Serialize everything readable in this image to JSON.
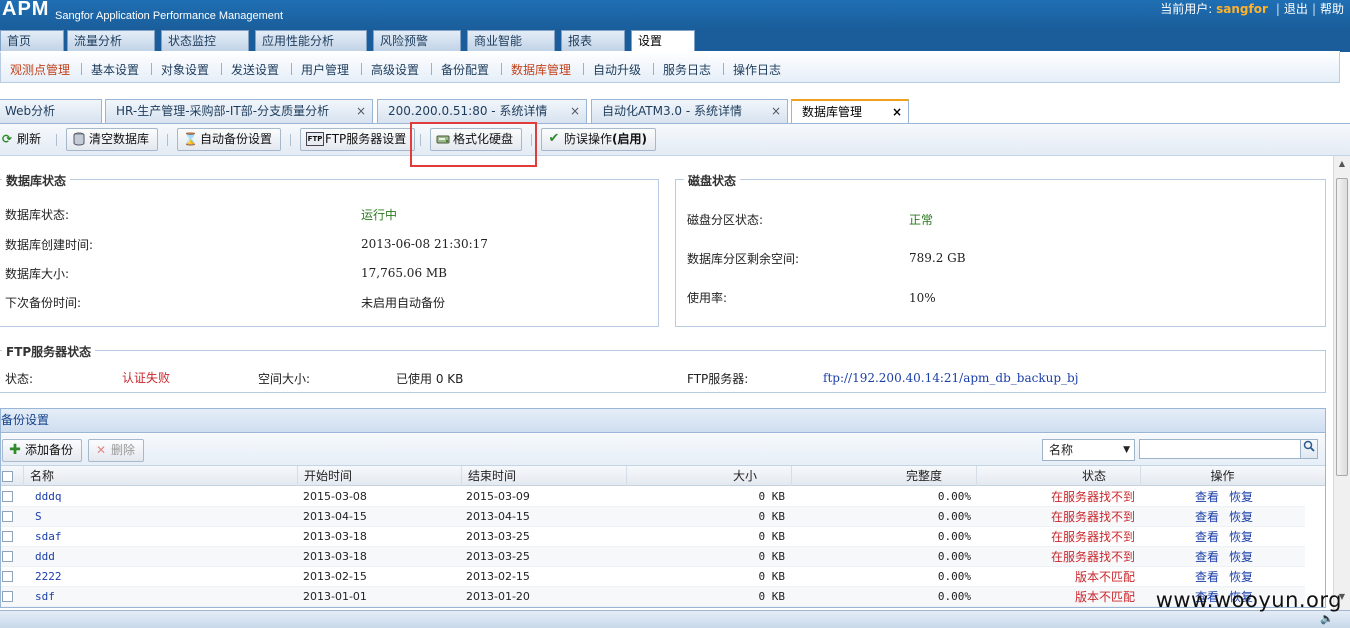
{
  "header": {
    "logo": "APM",
    "subtitle": "Sangfor Application Performance Management",
    "current_user_label": "当前用户:",
    "username": "sangfor",
    "logout": "退出",
    "help": "帮助"
  },
  "main_nav": [
    "首页",
    "流量分析",
    "状态监控",
    "应用性能分析",
    "风险预警",
    "商业智能",
    "报表",
    "设置"
  ],
  "sub_nav": [
    "观测点管理",
    "基本设置",
    "对象设置",
    "发送设置",
    "用户管理",
    "高级设置",
    "备份配置",
    "数据库管理",
    "自动升级",
    "服务日志",
    "操作日志"
  ],
  "page_tabs": [
    {
      "label": "Web分析"
    },
    {
      "label": "HR-生产管理-采购部-IT部-分支质量分析"
    },
    {
      "label": "200.200.0.51:80 - 系统详情"
    },
    {
      "label": "自动化ATM3.0 - 系统详情"
    },
    {
      "label": "数据库管理"
    }
  ],
  "close_glyph": "×",
  "toolbar": {
    "refresh": "刷新",
    "clear_db": "清空数据库",
    "auto_backup": "自动备份设置",
    "ftp_settings": "FTP服务器设置",
    "format_disk": "格式化硬盘",
    "protect_prefix": "防误操作",
    "protect_suffix": "(启用)"
  },
  "db_status": {
    "title": "数据库状态",
    "rows": [
      {
        "label": "数据库状态:",
        "value": "运行中"
      },
      {
        "label": "数据库创建时间:",
        "value": "2013-06-08 21:30:17"
      },
      {
        "label": "数据库大小:",
        "value": "17,765.06 MB"
      },
      {
        "label": "下次备份时间:",
        "value": "未启用自动备份"
      }
    ]
  },
  "disk_status": {
    "title": "磁盘状态",
    "rows": [
      {
        "label": "磁盘分区状态:",
        "value": "正常"
      },
      {
        "label": "数据库分区剩余空间:",
        "value": "789.2 GB"
      },
      {
        "label": "使用率:",
        "value": "10%"
      }
    ]
  },
  "ftp_status": {
    "title": "FTP服务器状态",
    "status_label": "状态:",
    "status_value": "认证失败",
    "space_label": "空间大小:",
    "space_value": "已使用 0 KB",
    "server_label": "FTP服务器:",
    "server_value": "ftp://192.200.40.14:21/apm_db_backup_bj"
  },
  "backup": {
    "title": "备份设置",
    "add_label": "添加备份",
    "delete_label": "删除",
    "search_field": "名称",
    "search_placeholder": "",
    "columns": [
      "名称",
      "开始时间",
      "结束时间",
      "大小",
      "完整度",
      "状态",
      "操作"
    ],
    "rows": [
      {
        "name": "dddq",
        "start": "2015-03-08",
        "end": "2015-03-09",
        "size": "0 KB",
        "integrity": "0.00%",
        "status": "在服务器找不到"
      },
      {
        "name": "S",
        "start": "2013-04-15",
        "end": "2013-04-15",
        "size": "0 KB",
        "integrity": "0.00%",
        "status": "在服务器找不到"
      },
      {
        "name": "sdaf",
        "start": "2013-03-18",
        "end": "2013-03-25",
        "size": "0 KB",
        "integrity": "0.00%",
        "status": "在服务器找不到"
      },
      {
        "name": "ddd",
        "start": "2013-03-18",
        "end": "2013-03-25",
        "size": "0 KB",
        "integrity": "0.00%",
        "status": "在服务器找不到"
      },
      {
        "name": "2222",
        "start": "2013-02-15",
        "end": "2013-02-15",
        "size": "0 KB",
        "integrity": "0.00%",
        "status": "版本不匹配"
      },
      {
        "name": "sdf",
        "start": "2013-01-01",
        "end": "2013-01-20",
        "size": "0 KB",
        "integrity": "0.00%",
        "status": "版本不匹配"
      }
    ],
    "view_label": "查看",
    "restore_label": "恢复"
  },
  "watermark": "www.wooyun.org",
  "colors": {
    "header_blue": "#1a5d9a",
    "active_orange": "#c2401b",
    "status_red": "#c8282d",
    "ok_green": "#2a7a1e",
    "highlight_box": "#e23b3b"
  }
}
